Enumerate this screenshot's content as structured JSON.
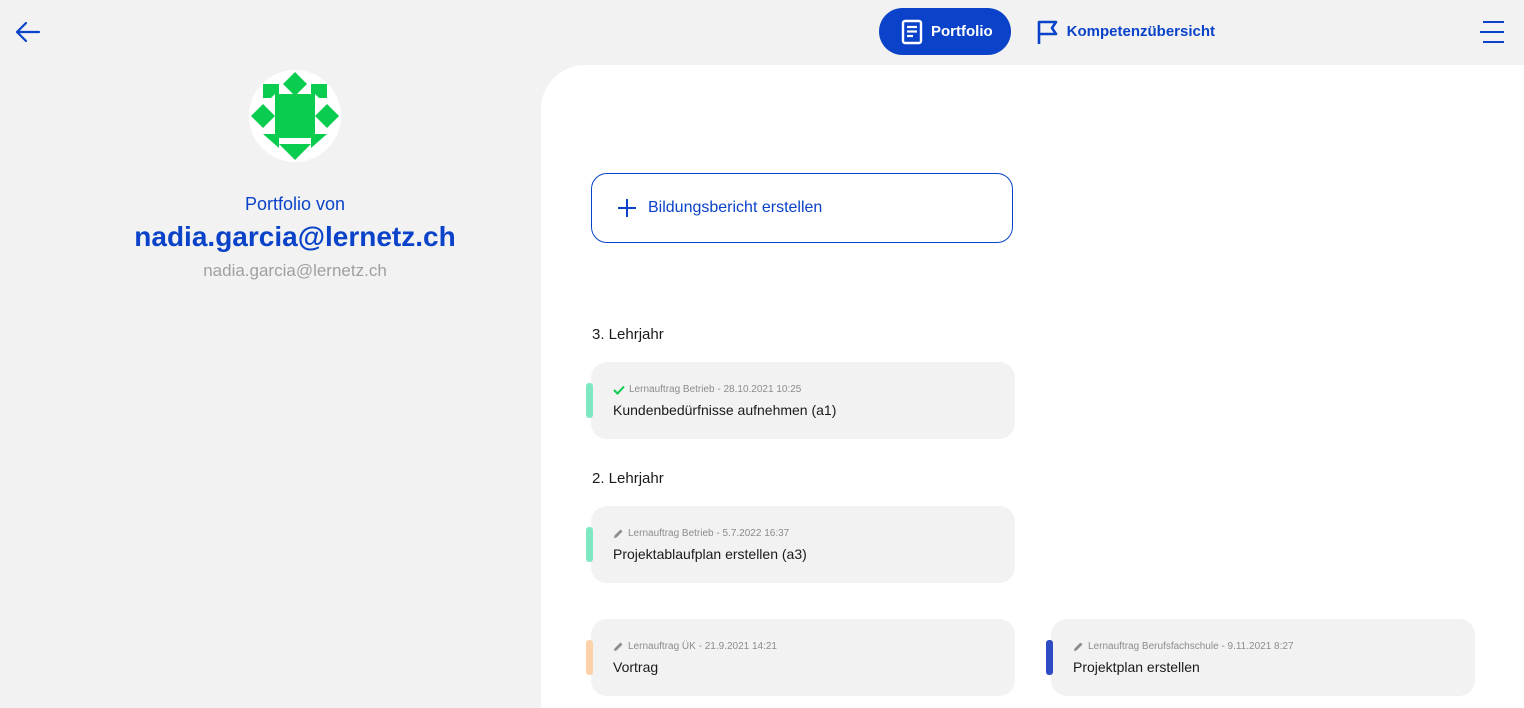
{
  "nav": {
    "active_label": "Portfolio",
    "link_label": "Kompetenzübersicht",
    "accent": "#0a43c9"
  },
  "profile": {
    "portfolio_von": "Portfolio von",
    "name": "nadia.garcia@lernetz.ch",
    "email": "nadia.garcia@lernetz.ch",
    "avatar_color": "#0acc4e"
  },
  "actions": {
    "create_label": "Bildungsbericht erstellen"
  },
  "sections": [
    {
      "year": "3. Lehrjahr",
      "cards": [
        {
          "meta": "Lernauftrag Betrieb - 28.10.2021 10:25",
          "title": "Kundenbedürfnisse aufnehmen (a1)",
          "status_icon": "check-icon",
          "bar_color": "#7ee8c0"
        }
      ]
    },
    {
      "year": "2. Lehrjahr",
      "cards": [
        {
          "meta": "Lernauftrag Betrieb - 5.7.2022 16:37",
          "title": "Projektablaufplan erstellen (a3)",
          "status_icon": "pencil-icon",
          "bar_color": "#7ee8c0"
        },
        {
          "meta": "Lernauftrag ÜK - 21.9.2021 14:21",
          "title": "Vortrag",
          "status_icon": "pencil-icon",
          "bar_color": "#fdd2a8"
        },
        {
          "meta": "Lernauftrag Berufsfachschule - 9.11.2021 8:27",
          "title": "Projektplan erstellen",
          "status_icon": "pencil-icon",
          "bar_color": "#2f4bc4"
        }
      ]
    }
  ]
}
